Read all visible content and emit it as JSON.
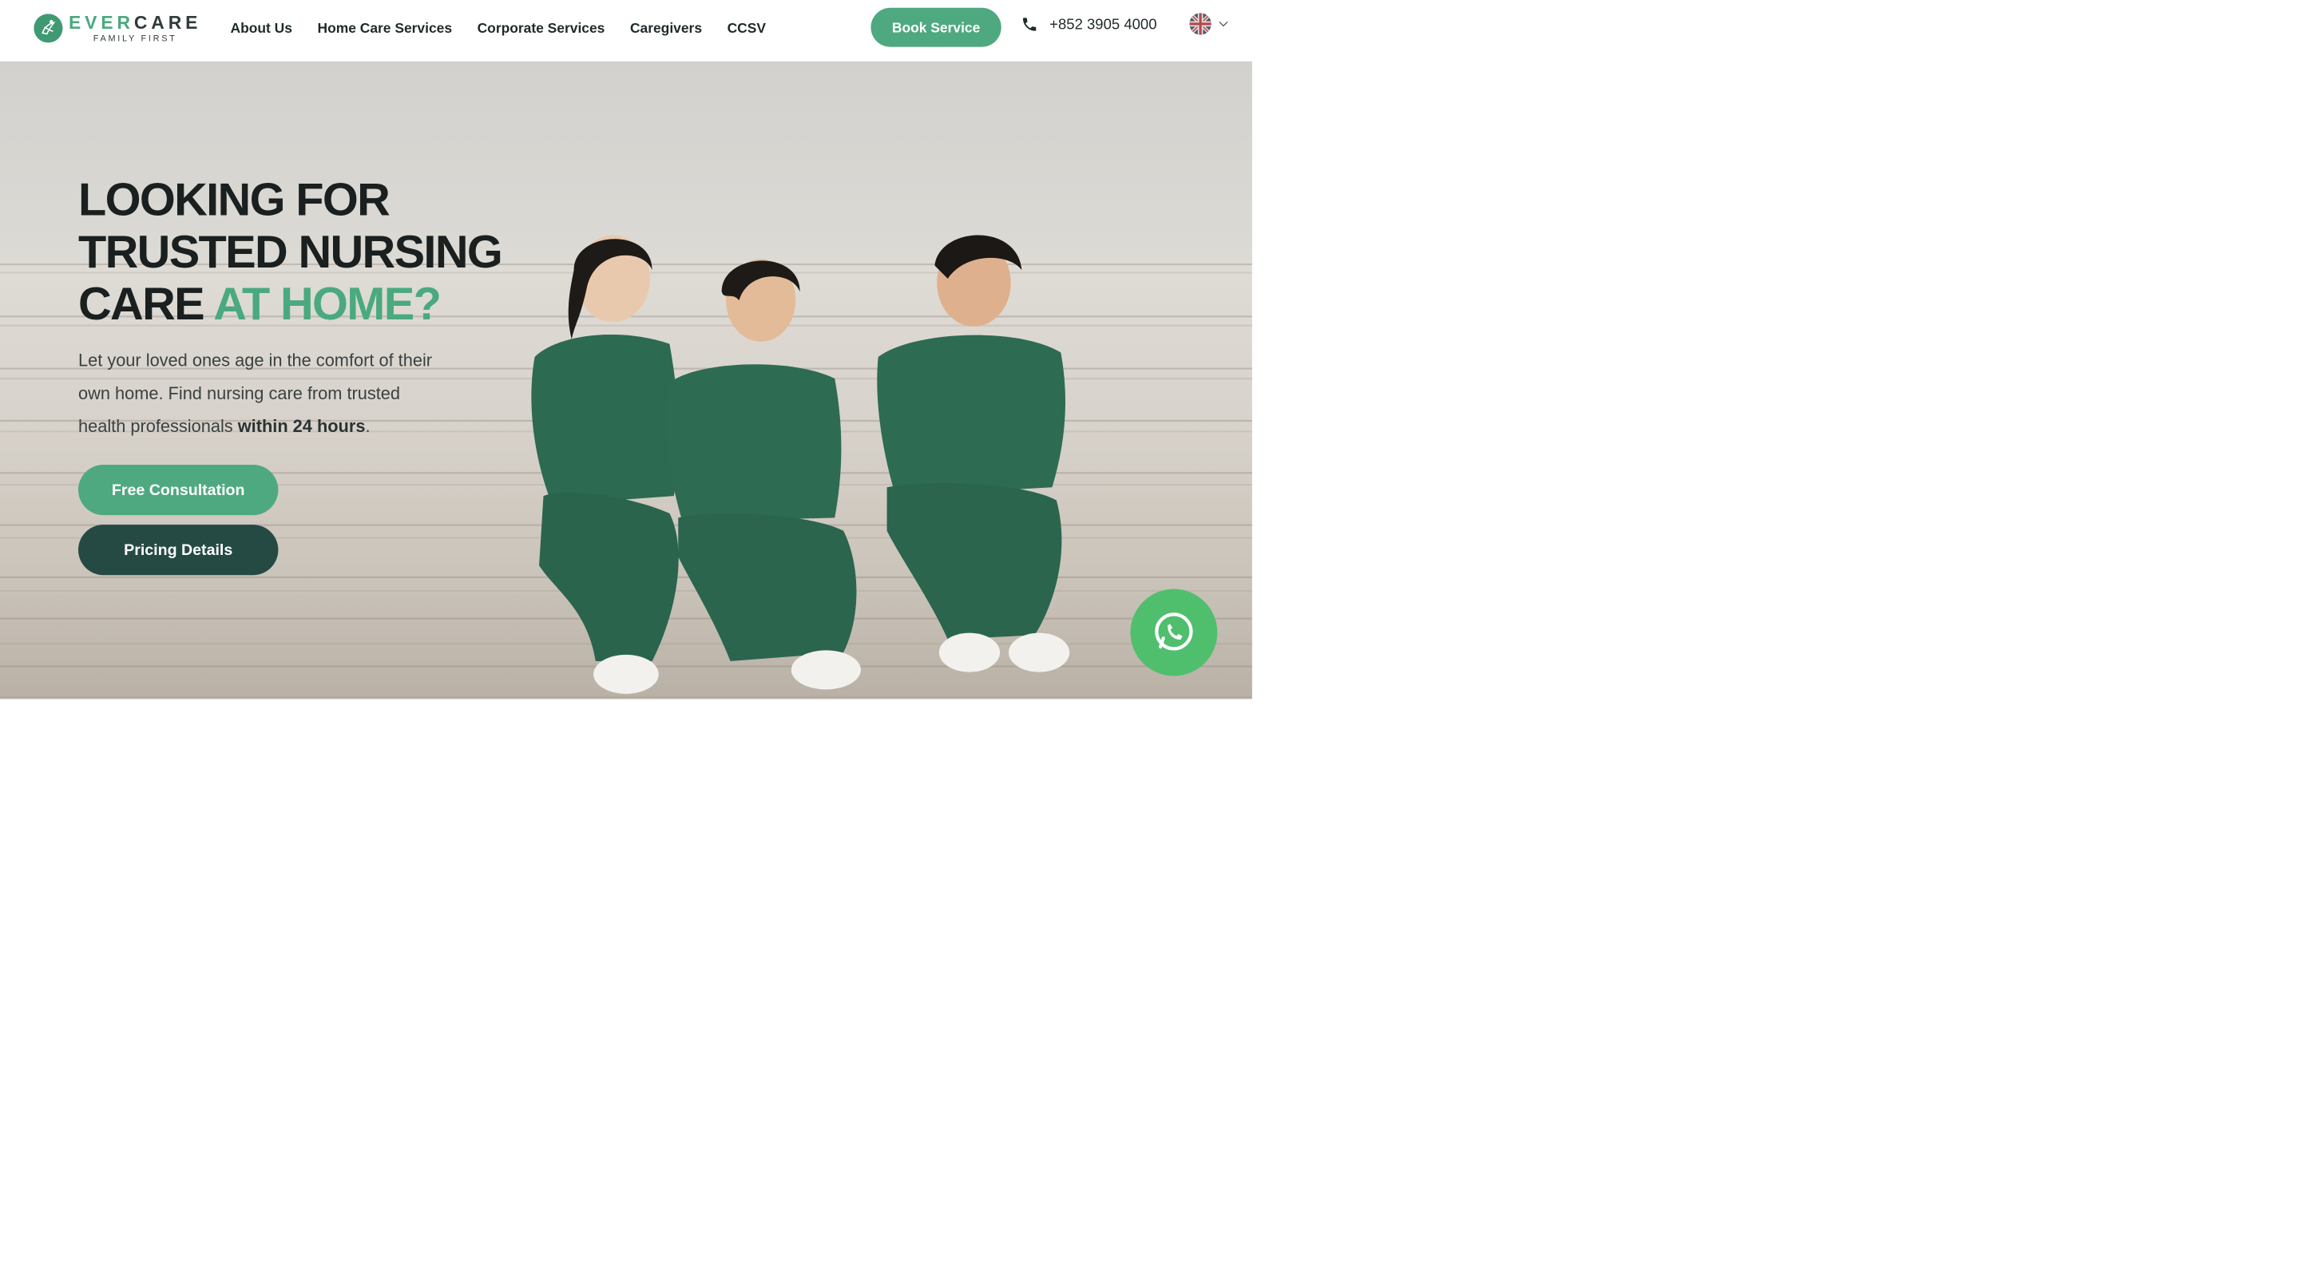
{
  "header": {
    "logo": {
      "brand_ever": "EVER",
      "brand_care": "CARE",
      "tagline": "FAMILY FIRST"
    },
    "nav": [
      {
        "label": "About Us"
      },
      {
        "label": "Home Care Services"
      },
      {
        "label": "Corporate Services"
      },
      {
        "label": "Caregivers"
      },
      {
        "label": "CCSV"
      }
    ],
    "book_label": "Book Service",
    "phone": "+852 3905 4000",
    "language_icon": "uk-flag-icon"
  },
  "hero": {
    "headline_line1": "LOOKING FOR",
    "headline_line2": "TRUSTED NURSING",
    "headline_line3_plain": "CARE ",
    "headline_line3_accent": "AT HOME?",
    "subtext_plain": "Let your loved ones age in the comfort of their own home. Find nursing care from trusted health professionals ",
    "subtext_bold": "within 24 hours",
    "subtext_end": ".",
    "cta_primary": "Free Consultation",
    "cta_secondary": "Pricing Details"
  },
  "floating": {
    "whatsapp_icon": "whatsapp-icon"
  },
  "colors": {
    "accent": "#4fa980",
    "dark_accent": "#254a44",
    "whatsapp": "#4fbf6e"
  }
}
